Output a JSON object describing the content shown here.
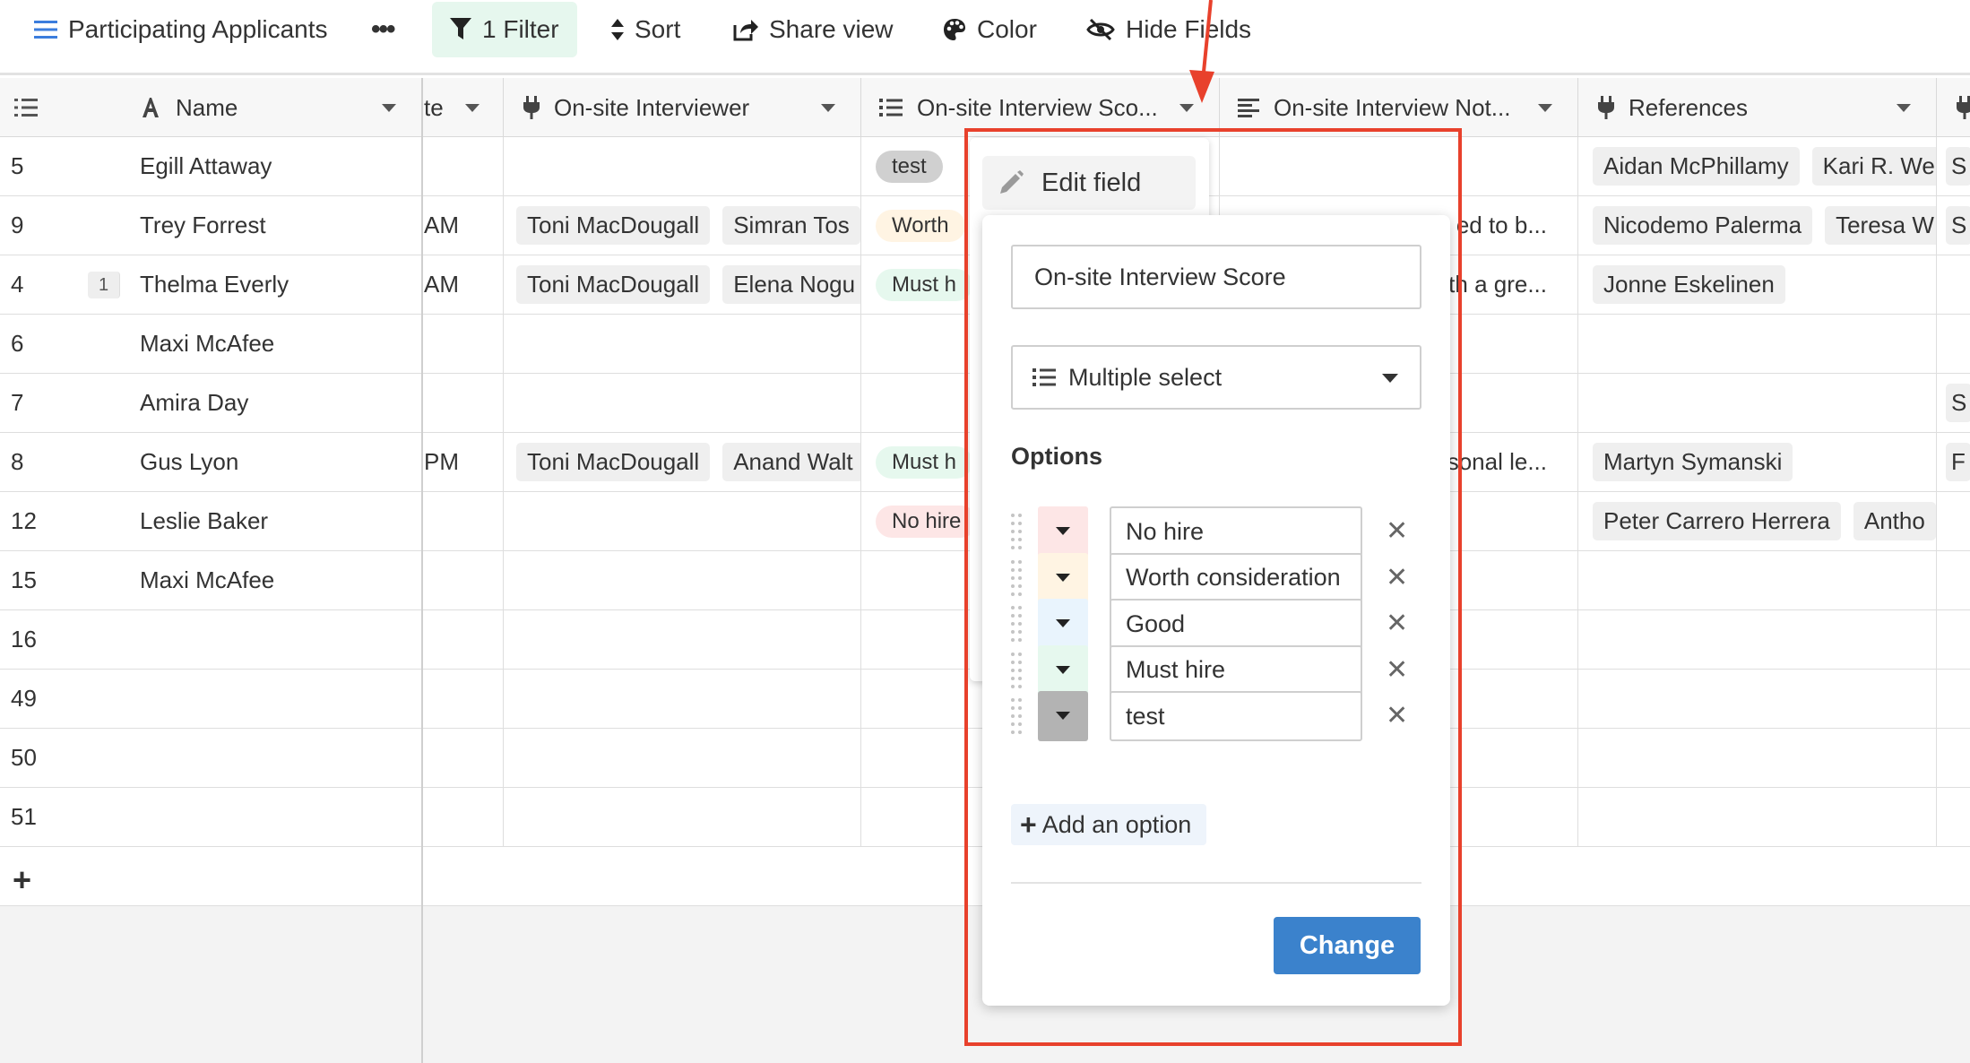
{
  "toolbar": {
    "view_name": "Participating Applicants",
    "more": "•••",
    "filter": "1 Filter",
    "sort": "Sort",
    "share": "Share view",
    "color": "Color",
    "hide": "Hide Fields"
  },
  "columns": {
    "date": "te",
    "name": "Name",
    "interviewer": "On-site Interviewer",
    "score": "On-site Interview Sco...",
    "notes": "On-site Interview Not...",
    "references": "References"
  },
  "rows": [
    {
      "num": "5",
      "name": "Egill Attaway",
      "date": "",
      "interviewers": [],
      "score": {
        "label": "test",
        "color": "#d0d0d0"
      },
      "notes": "",
      "references": [
        "Aidan McPhillamy",
        "Kari R. We"
      ],
      "last": "S"
    },
    {
      "num": "9",
      "name": "Trey Forrest",
      "date": "AM",
      "interviewers": [
        "Toni MacDougall",
        "Simran Tos"
      ],
      "score": {
        "label": "Worth",
        "color": "#fff4e3"
      },
      "notes": "ed to b...",
      "references": [
        "Nicodemo Palerma",
        "Teresa W"
      ],
      "last": "S"
    },
    {
      "num": "4",
      "comments": "1",
      "name": "Thelma Everly",
      "date": "AM",
      "interviewers": [
        "Toni MacDougall",
        "Elena Nogu"
      ],
      "score": {
        "label": "Must h",
        "color": "#e6f8ee"
      },
      "notes": "th a gre...",
      "references": [
        "Jonne Eskelinen"
      ],
      "last": ""
    },
    {
      "num": "6",
      "name": "Maxi McAfee",
      "date": "",
      "interviewers": [],
      "score": null,
      "notes": "",
      "references": [],
      "last": ""
    },
    {
      "num": "7",
      "name": "Amira Day",
      "date": "",
      "interviewers": [],
      "score": null,
      "notes": "",
      "references": [],
      "last": "S"
    },
    {
      "num": "8",
      "name": "Gus Lyon",
      "date": "PM",
      "interviewers": [
        "Toni MacDougall",
        "Anand Walt"
      ],
      "score": {
        "label": "Must h",
        "color": "#e6f8ee"
      },
      "notes": "sonal le...",
      "references": [
        "Martyn Symanski"
      ],
      "last": "F"
    },
    {
      "num": "12",
      "name": "Leslie Baker",
      "date": "",
      "interviewers": [],
      "score": {
        "label": "No hire",
        "color": "#fde6e6"
      },
      "notes": "",
      "references": [
        "Peter Carrero Herrera",
        "Antho"
      ],
      "last": ""
    },
    {
      "num": "15",
      "name": "Maxi McAfee",
      "date": "",
      "interviewers": [],
      "score": null,
      "notes": "",
      "references": [],
      "last": ""
    },
    {
      "num": "16",
      "name": "",
      "date": "",
      "interviewers": [],
      "score": null,
      "notes": "",
      "references": [],
      "last": ""
    },
    {
      "num": "49",
      "name": "",
      "date": "",
      "interviewers": [],
      "score": null,
      "notes": "",
      "references": [],
      "last": ""
    },
    {
      "num": "50",
      "name": "",
      "date": "",
      "interviewers": [],
      "score": null,
      "notes": "",
      "references": [],
      "last": ""
    },
    {
      "num": "51",
      "name": "",
      "date": "",
      "interviewers": [],
      "score": null,
      "notes": "",
      "references": [],
      "last": ""
    }
  ],
  "add_row": "+",
  "popup": {
    "edit_field": "Edit field",
    "field_name": "On-site Interview Score",
    "field_type": "Multiple select",
    "options_label": "Options",
    "options": [
      {
        "label": "No hire",
        "color": "#fde6e6"
      },
      {
        "label": "Worth consideration",
        "color": "#fff4e3"
      },
      {
        "label": "Good",
        "color": "#e9f4fd"
      },
      {
        "label": "Must hire",
        "color": "#e6f8ee"
      },
      {
        "label": "test",
        "color": "#b3b3b3"
      }
    ],
    "add_option": "Add an option",
    "change": "Change"
  },
  "colors": {
    "accent": "#3b82cc",
    "filter_bg": "#e6f7ee",
    "annotation": "#e8412c"
  }
}
